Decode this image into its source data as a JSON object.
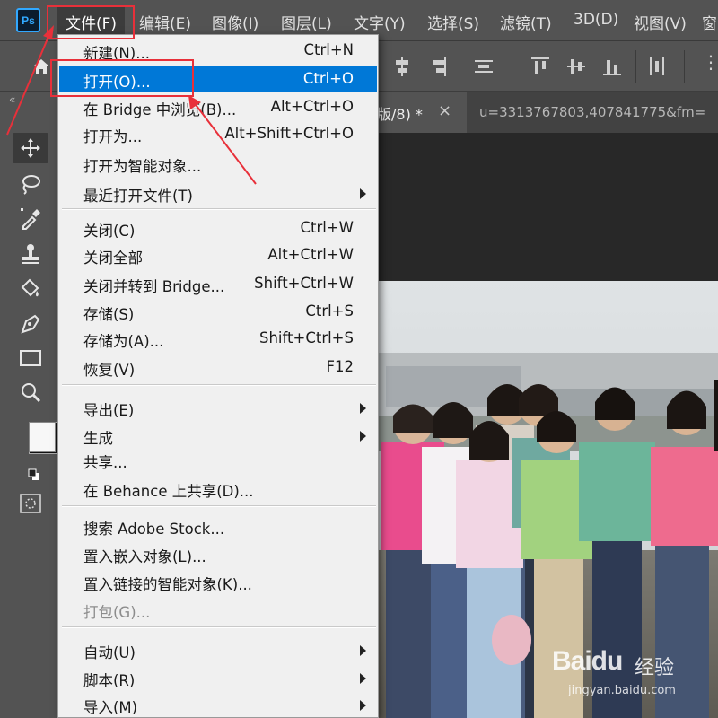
{
  "app": {
    "logo_text": "Ps"
  },
  "menubar": {
    "items": [
      {
        "label": "文件(F)"
      },
      {
        "label": "编辑(E)"
      },
      {
        "label": "图像(I)"
      },
      {
        "label": "图层(L)"
      },
      {
        "label": "文字(Y)"
      },
      {
        "label": "选择(S)"
      },
      {
        "label": "滤镜(T)"
      },
      {
        "label": "3D(D)"
      },
      {
        "label": "视图(V)"
      },
      {
        "label": "窗"
      }
    ]
  },
  "tabs": {
    "collapse": "«",
    "active_label": "版/8) *",
    "close": "×",
    "second_label": "u=3313767803,407841775&fm="
  },
  "file_menu": {
    "items": [
      {
        "label": "新建(N)...",
        "shortcut": "Ctrl+N"
      },
      {
        "label": "打开(O)...",
        "shortcut": "Ctrl+O"
      },
      {
        "label": "在 Bridge 中浏览(B)...",
        "shortcut": "Alt+Ctrl+O"
      },
      {
        "label": "打开为...",
        "shortcut": "Alt+Shift+Ctrl+O"
      },
      {
        "label": "打开为智能对象...",
        "shortcut": ""
      },
      {
        "label": "最近打开文件(T)",
        "shortcut": ""
      },
      {
        "label": "关闭(C)",
        "shortcut": "Ctrl+W"
      },
      {
        "label": "关闭全部",
        "shortcut": "Alt+Ctrl+W"
      },
      {
        "label": "关闭并转到 Bridge...",
        "shortcut": "Shift+Ctrl+W"
      },
      {
        "label": "存储(S)",
        "shortcut": "Ctrl+S"
      },
      {
        "label": "存储为(A)...",
        "shortcut": "Shift+Ctrl+S"
      },
      {
        "label": "恢复(V)",
        "shortcut": "F12"
      },
      {
        "label": "导出(E)",
        "shortcut": ""
      },
      {
        "label": "生成",
        "shortcut": ""
      },
      {
        "label": "共享...",
        "shortcut": ""
      },
      {
        "label": "在 Behance 上共享(D)...",
        "shortcut": ""
      },
      {
        "label": "搜索 Adobe Stock...",
        "shortcut": ""
      },
      {
        "label": "置入嵌入对象(L)...",
        "shortcut": ""
      },
      {
        "label": "置入链接的智能对象(K)...",
        "shortcut": ""
      },
      {
        "label": "打包(G)...",
        "shortcut": ""
      },
      {
        "label": "自动(U)",
        "shortcut": ""
      },
      {
        "label": "脚本(R)",
        "shortcut": ""
      },
      {
        "label": "导入(M)",
        "shortcut": ""
      }
    ]
  },
  "watermark": {
    "brand": "Baidu",
    "product": "经验",
    "url": "jingyan.baidu.com"
  },
  "colors": {
    "highlight": "#0078d7",
    "annotation": "#e8303a",
    "ui_dark": "#535353"
  }
}
